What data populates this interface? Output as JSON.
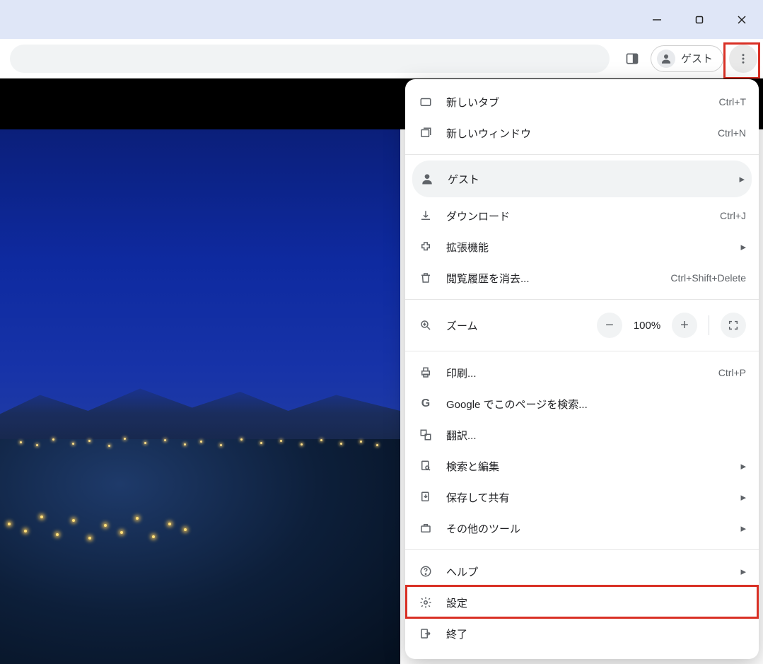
{
  "toolbar": {
    "guest_label": "ゲスト"
  },
  "menu": {
    "new_tab": {
      "label": "新しいタブ",
      "shortcut": "Ctrl+T"
    },
    "new_window": {
      "label": "新しいウィンドウ",
      "shortcut": "Ctrl+N"
    },
    "guest": {
      "label": "ゲスト"
    },
    "downloads": {
      "label": "ダウンロード",
      "shortcut": "Ctrl+J"
    },
    "extensions": {
      "label": "拡張機能"
    },
    "clear_history": {
      "label": "閲覧履歴を消去...",
      "shortcut": "Ctrl+Shift+Delete"
    },
    "zoom": {
      "label": "ズーム",
      "value": "100%"
    },
    "print": {
      "label": "印刷...",
      "shortcut": "Ctrl+P"
    },
    "google_search": {
      "label": "Google でこのページを検索..."
    },
    "translate": {
      "label": "翻訳..."
    },
    "find_edit": {
      "label": "検索と編集"
    },
    "save_share": {
      "label": "保存して共有"
    },
    "more_tools": {
      "label": "その他のツール"
    },
    "help": {
      "label": "ヘルプ"
    },
    "settings": {
      "label": "設定"
    },
    "exit": {
      "label": "終了"
    }
  }
}
